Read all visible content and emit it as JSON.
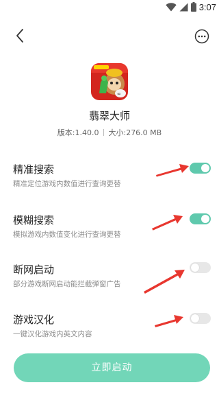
{
  "status_bar": {
    "time": "3:07",
    "icons": [
      "wifi-icon",
      "signal-icon",
      "battery-icon"
    ]
  },
  "nav": {
    "back_icon": "chevron-left-icon",
    "more_icon": "more-horizontal-icon"
  },
  "app": {
    "name": "翡翠大师",
    "version": "版本:1.40.0",
    "size": "大小:276.0 MB",
    "icon": "game-app-icon"
  },
  "settings": [
    {
      "title": "精准搜索",
      "desc": "精准定位游戏内数值进行查询更替",
      "enabled": true
    },
    {
      "title": "模糊搜索",
      "desc": "模拟游戏内数值变化进行查询更替",
      "enabled": true
    },
    {
      "title": "断网启动",
      "desc": "部分游戏断网启动能拦截弹窗广告",
      "enabled": false
    },
    {
      "title": "游戏汉化",
      "desc": "一键汉化游戏内英文内容",
      "enabled": false
    }
  ],
  "launch_button": "立即启动",
  "colors": {
    "accent": "#5fc9ad",
    "button": "#72d6b8",
    "toggle_off": "#e7e7e7",
    "arrow": "#e8372f"
  }
}
